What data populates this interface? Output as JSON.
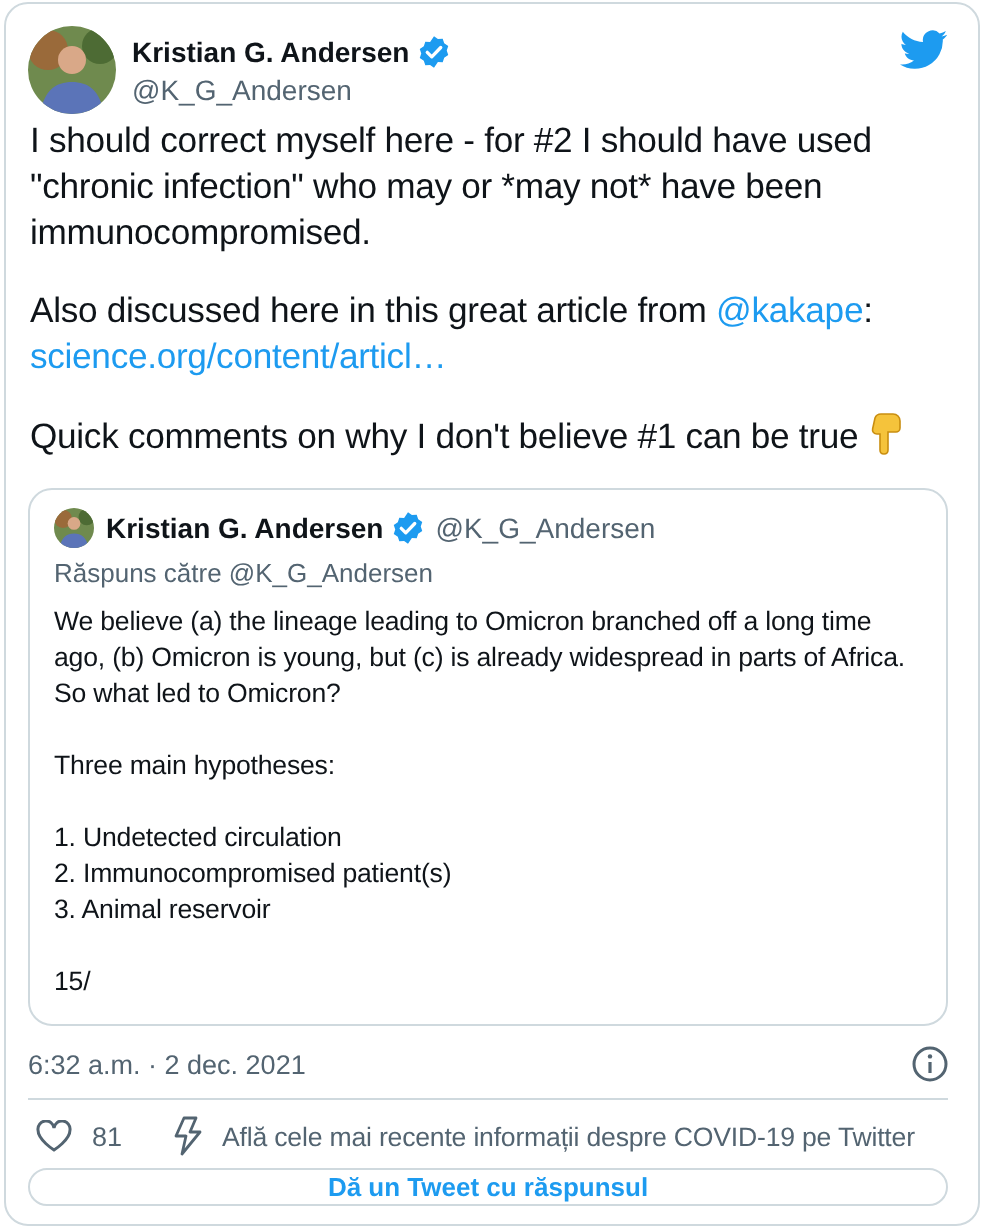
{
  "author": {
    "name": "Kristian G. Andersen",
    "handle": "@K_G_Andersen",
    "verified": true
  },
  "paragraphs": [
    [
      {
        "kind": "text",
        "text": "I should correct myself here - for #2 I should have used \"chronic infection\" who may or *may not* have been immunocompromised."
      }
    ],
    [
      {
        "kind": "text",
        "text": "Also discussed here in this great article from "
      },
      {
        "kind": "link",
        "text": "@kakape"
      },
      {
        "kind": "text",
        "text": ": "
      },
      {
        "kind": "link",
        "text": "science.org/content/articl…"
      }
    ],
    [
      {
        "kind": "text",
        "text": "Quick comments on why I don't believe #1 can be true "
      },
      {
        "kind": "emoji"
      }
    ]
  ],
  "quote": {
    "name": "Kristian G. Andersen",
    "verified": true,
    "handle": "@K_G_Andersen",
    "reply_to": "Răspuns către @K_G_Andersen",
    "blocks": [
      [
        "We believe (a) the lineage leading to Omicron branched off a long time ago, (b) Omicron is young, but (c) is already widespread in parts of Africa. So what led to Omicron?"
      ],
      [
        "Three main hypotheses:"
      ],
      [
        "1. Undetected circulation",
        "2. Immunocompromised patient(s)",
        "3. Animal reservoir"
      ],
      [
        "15/"
      ]
    ]
  },
  "timestamp": "6:32 a.m. · 2 dec. 2021",
  "likes": "81",
  "topic_link": "Află cele mai recente informații despre COVID-19 pe Twitter",
  "reply_button": "Dă un Tweet cu răspunsul"
}
